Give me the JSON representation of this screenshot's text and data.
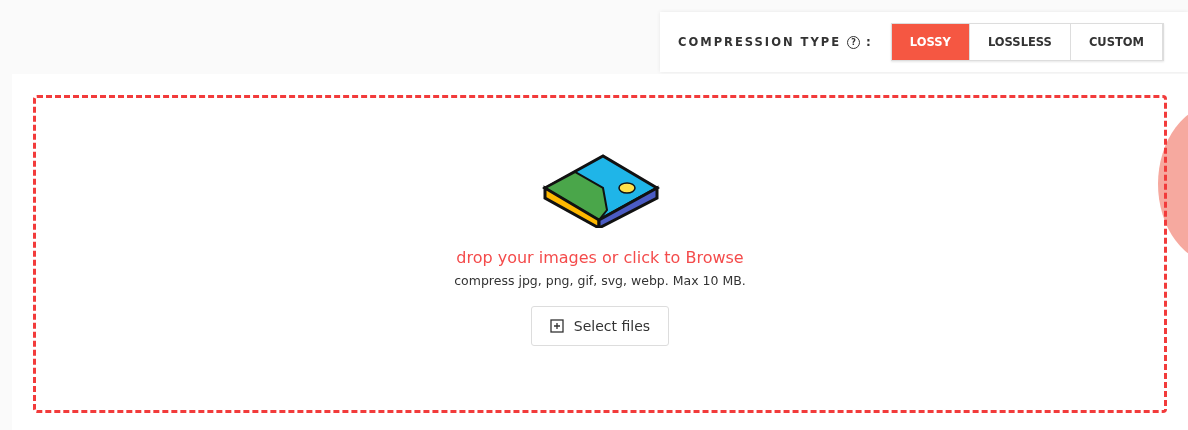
{
  "compression": {
    "label": "COMPRESSION TYPE",
    "help_icon": "?",
    "separator": ":",
    "options": [
      {
        "label": "LOSSY",
        "selected": true
      },
      {
        "label": "LOSSLESS",
        "selected": false
      },
      {
        "label": "CUSTOM",
        "selected": false
      }
    ]
  },
  "dropzone": {
    "title": "drop your images or click to Browse",
    "subtitle": "compress jpg, png, gif, svg, webp. Max 10 MB.",
    "button": "Select files"
  }
}
